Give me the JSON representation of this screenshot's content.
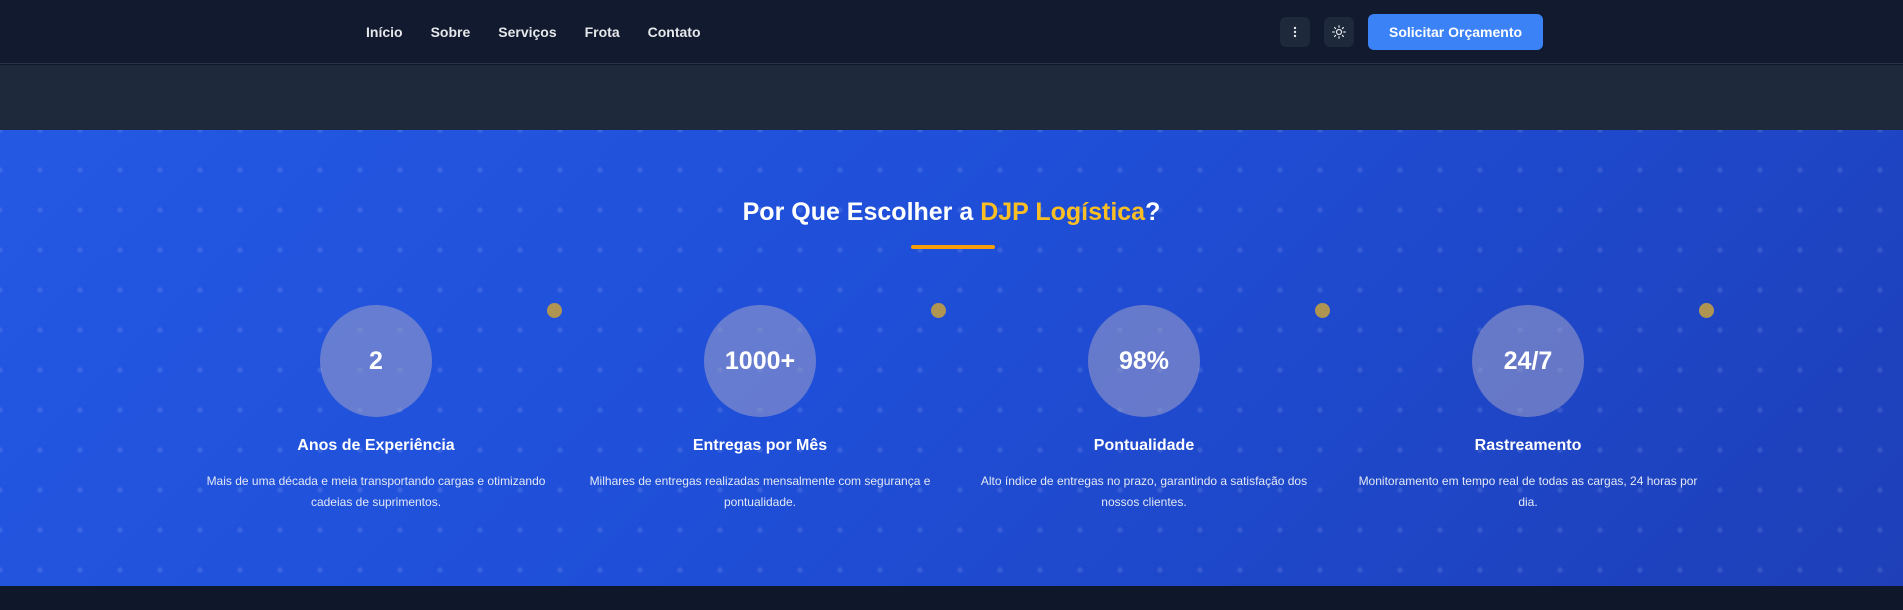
{
  "nav": {
    "links": [
      "Início",
      "Sobre",
      "Serviços",
      "Frota",
      "Contato"
    ],
    "menu_icon": "more-vertical-icon",
    "theme_icon": "sun-icon",
    "cta_label": "Solicitar Orçamento"
  },
  "why": {
    "title_prefix": "Por Que Escolher a ",
    "title_brand": "DJP Logística",
    "title_suffix": "?",
    "stats": [
      {
        "value": "2",
        "label": "Anos de Experiência",
        "description": "Mais de uma década e meia transportando cargas e otimizando cadeias de suprimentos."
      },
      {
        "value": "1000+",
        "label": "Entregas por Mês",
        "description": "Milhares de entregas realizadas mensalmente com segurança e pontualidade."
      },
      {
        "value": "98%",
        "label": "Pontualidade",
        "description": "Alto índice de entregas no prazo, garantindo a satisfação dos nossos clientes."
      },
      {
        "value": "24/7",
        "label": "Rastreamento",
        "description": "Monitoramento em tempo real de todas as cargas, 24 horas por dia."
      }
    ]
  },
  "colors": {
    "accent": "#fbbf24",
    "primary": "#3b82f6",
    "nav_bg": "#111a2e",
    "section_bg": "#1f4fd8"
  }
}
